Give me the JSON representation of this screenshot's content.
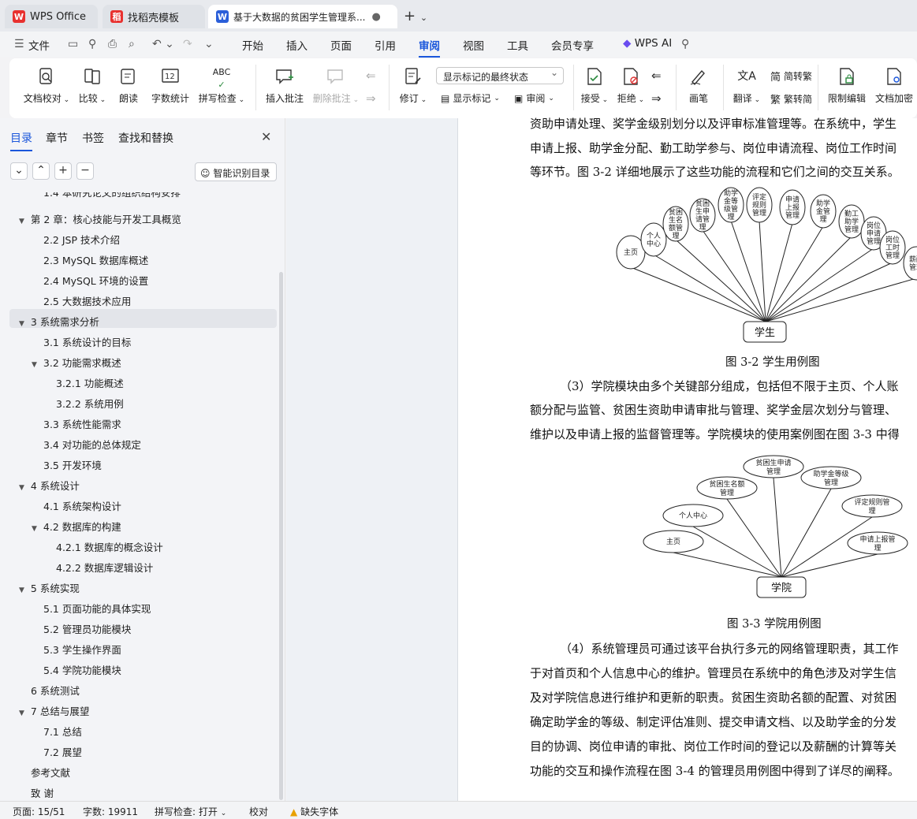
{
  "tabs": {
    "wps": "WPS Office",
    "template": "找稻壳模板",
    "doc": "基于大数据的贫困学生管理系..."
  },
  "menu": {
    "file": "文件",
    "items": [
      "开始",
      "插入",
      "页面",
      "引用",
      "审阅",
      "视图",
      "工具",
      "会员专享"
    ],
    "ai": "WPS AI"
  },
  "ribbon": {
    "proof": "文档校对",
    "compare": "比较",
    "read": "朗读",
    "wordcount": "字数统计",
    "spell": "拼写检查",
    "insert_comment": "插入批注",
    "delete_comment": "删除批注",
    "revise": "修订",
    "markup_state": "显示标记的最终状态",
    "show_markup": "显示标记",
    "review": "审阅",
    "accept": "接受",
    "reject": "拒绝",
    "pen": "画笔",
    "translate": "翻译",
    "to_trad": "简转繁",
    "to_simp": "繁转简",
    "restrict": "限制编辑",
    "encrypt": "文档加密"
  },
  "panel": {
    "tabs": [
      "目录",
      "章节",
      "书签",
      "查找和替换"
    ],
    "smart": "智能识别目录",
    "toc": [
      "1.4 本研究论文的组织结构安排",
      "第 2 章：核心技能与开发工具概览",
      "2.2 JSP 技术介绍",
      "2.3 MySQL  数据库概述",
      "2.4 MySQL 环境的设置",
      "2.5 大数据技术应用",
      "3 系统需求分析",
      "3.1 系统设计的目标",
      "3.2  功能需求概述",
      "3.2.1  功能概述",
      "3.2.2  系统用例",
      "3.3 系统性能需求",
      "3.4 对功能的总体规定",
      "3.5  开发环境",
      "4 系统设计",
      "4.1  系统架构设计",
      "4.2  数据库的构建",
      "4.2.1  数据库的概念设计",
      "4.2.2  数据库逻辑设计",
      "5 系统实现",
      "5.1  页面功能的具体实现",
      "5.2 管理员功能模块",
      "5.3  学生操作界面",
      "5.4  学院功能模块",
      "6 系统测试",
      "7 总结与展望",
      "7.1  总结",
      "7.2  展望",
      "参考文献",
      "致      谢"
    ]
  },
  "doc": {
    "p1": [
      "资助申请处理、奖学金级别划分以及评审标准管理等。在系统中，学生",
      "申请上报、助学金分配、勤工助学参与、岗位申请流程、岗位工作时间",
      "等环节。图 3-2 详细地展示了这些功能的流程和它们之间的交互关系。"
    ],
    "fig2_nodes": [
      "主页",
      "个人中心",
      "贫困生名额管理",
      "贫困生申请管理",
      "助学金等级管理",
      "评定规则管理",
      "申请上报管理",
      "助学金管理",
      "勤工助学管理",
      "岗位申请管理",
      "岗位工时管理",
      "薪酬管理"
    ],
    "fig2_actor": "学生",
    "fig2_caption": "图 3-2  学生用例图",
    "p2": [
      "（3）学院模块由多个关键部分组成，包括但不限于主页、个人账",
      "额分配与监管、贫困生资助申请审批与管理、奖学金层次划分与管理、",
      "维护以及申请上报的监督管理等。学院模块的使用案例图在图 3-3 中得"
    ],
    "fig3_nodes": [
      "主页",
      "个人中心",
      "贫困生名额管理",
      "贫困生申请管理",
      "助学金等级管理",
      "评定规则管理",
      "申请上报管理"
    ],
    "fig3_actor": "学院",
    "fig3_caption": "图 3-3 学院用例图",
    "p3": [
      "（4）系统管理员可通过该平台执行多元的网络管理职责，其工作",
      "于对首页和个人信息中心的维护。管理员在系统中的角色涉及对学生信",
      "及对学院信息进行维护和更新的职责。贫困生资助名额的配置、对贫困",
      "确定助学金的等级、制定评估准则、提交申请文档、以及助学金的分发",
      "目的协调、岗位申请的审批、岗位工作时间的登记以及薪酬的计算等关",
      "功能的交互和操作流程在图 3-4 的管理员用例图中得到了详尽的阐释。"
    ]
  },
  "status": {
    "page": "页面: 15/51",
    "words": "字数: 19911",
    "spell": "拼写检查: 打开",
    "proof": "校对",
    "font": "缺失字体"
  }
}
